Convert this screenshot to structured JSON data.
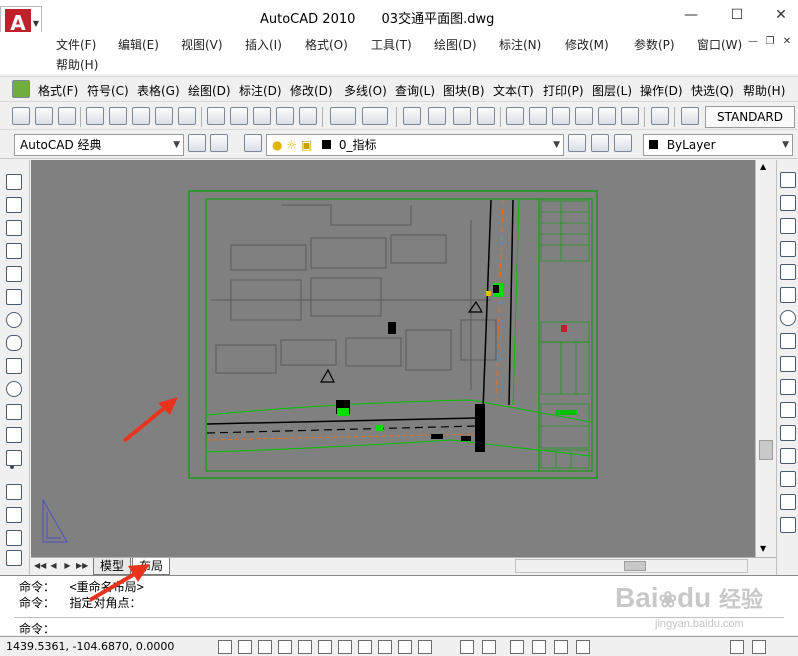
{
  "app": {
    "name": "AutoCAD 2010",
    "file": "03交通平面图.dwg"
  },
  "menu": [
    "文件(F)",
    "编辑(E)",
    "视图(V)",
    "插入(I)",
    "格式(O)",
    "工具(T)",
    "绘图(D)",
    "标注(N)",
    "修改(M)",
    "参数(P)",
    "窗口(W)",
    "帮助(H)"
  ],
  "express_menu": [
    "格式(F)",
    "符号(C)",
    "表格(G)",
    "绘图(D)",
    "标注(D)",
    "修改(D)",
    "多线(O)",
    "查询(L)",
    "图块(B)",
    "文本(T)",
    "打印(P)",
    "图层(L)",
    "操作(D)",
    "快选(Q)",
    "帮助(H)"
  ],
  "toolbar": {
    "text_style": "STANDARD"
  },
  "workspace": {
    "value": "AutoCAD 经典"
  },
  "layer": {
    "value": "0_指标"
  },
  "linetype": {
    "value": "ByLayer"
  },
  "tabs": {
    "model": "模型",
    "layout": "布局"
  },
  "command": {
    "line1": "命令：  <重命名布局>",
    "line2": "命令：  指定对角点：",
    "prompt": "命令："
  },
  "status": {
    "coords": "1439.5361,  -104.6870,  0.0000"
  },
  "watermark": {
    "brand": "Bai",
    "brand2": "du",
    "suffix": "经验",
    "sub": "jingyan.baidu.com"
  },
  "colors": {
    "canvas": "#808080",
    "highlight_arrow": "#e8341c",
    "frame": "#00a000",
    "logo": "#c0202a"
  }
}
